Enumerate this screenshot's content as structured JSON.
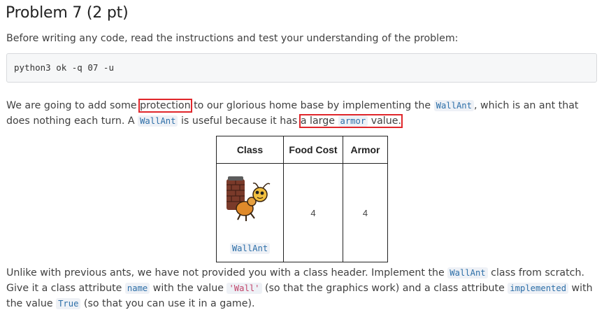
{
  "title": "Problem 7 (2 pt)",
  "intro": "Before writing any code, read the instructions and test your understanding of the problem:",
  "command": "python3 ok -q 07 -u",
  "paragraph1": {
    "t1": "We are going to add some ",
    "highlight1": "protection",
    "t2": " to our glorious home base by implementing the ",
    "code1": "WallAnt",
    "t3": ", which is an ant that does nothing each turn. A ",
    "code2": "WallAnt",
    "t4": " is useful because it has ",
    "hl2_pre": "a large ",
    "hl2_code": "armor",
    "hl2_post": " value."
  },
  "table": {
    "headers": [
      "Class",
      "Food Cost",
      "Armor"
    ],
    "row": {
      "class_label": "WallAnt",
      "food_cost": "4",
      "armor": "4"
    }
  },
  "paragraph2": {
    "t1": "Unlike with previous ants, we have not provided you with a class header. Implement the ",
    "code1": "WallAnt",
    "t2": " class from scratch. Give it a class attribute ",
    "code2": "name",
    "t3": " with the value ",
    "code3": "'Wall'",
    "t4": " (so that the graphics work) and a class attribute ",
    "code4": "implemented",
    "t5": " with the value ",
    "code5": "True",
    "t6": " (so that you can use it in a game)."
  },
  "colors": {
    "highlight_box": "#e0262b",
    "code_text": "#2d6fa8",
    "string_text": "#c2456a"
  }
}
